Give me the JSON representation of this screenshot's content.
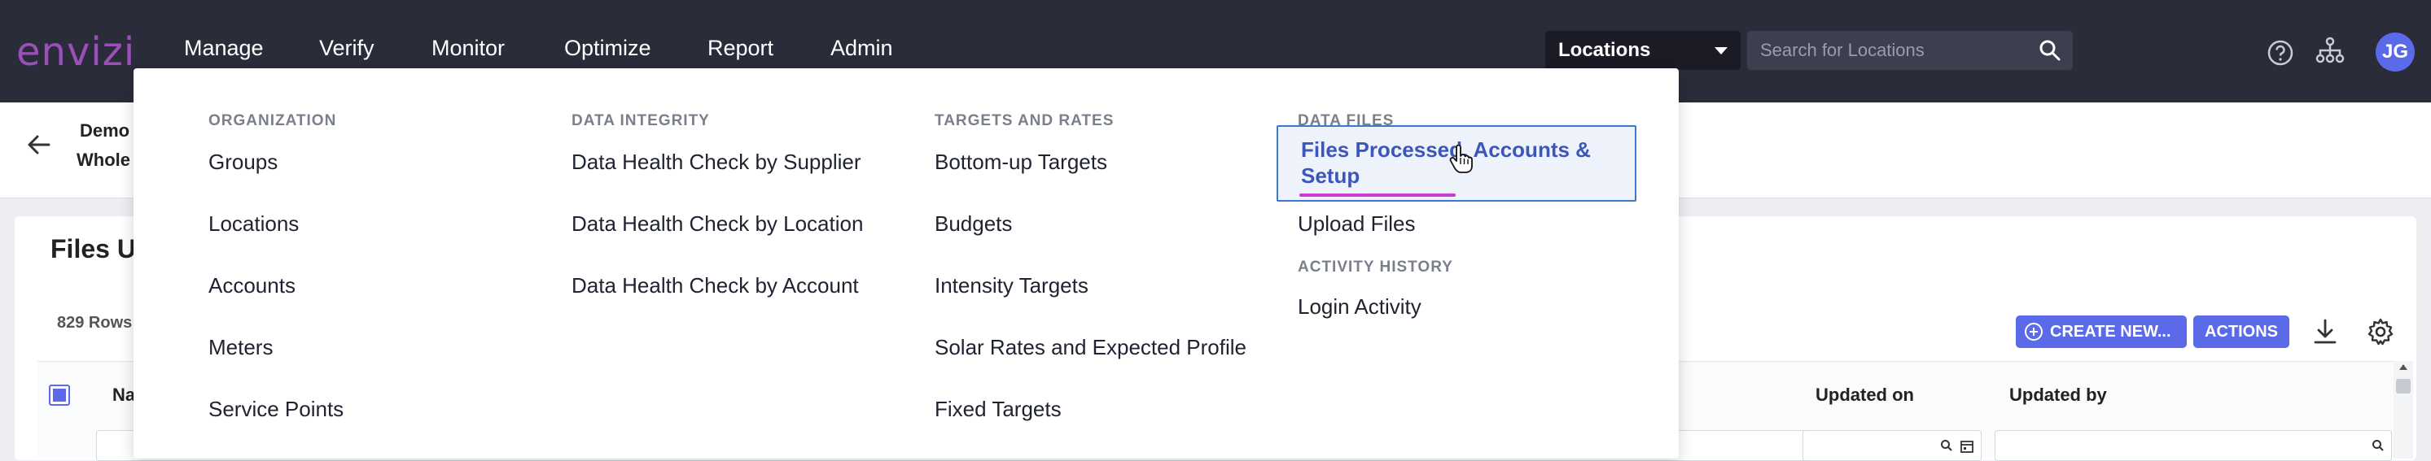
{
  "app": {
    "logo": "envizi"
  },
  "topnav": {
    "items": [
      "Manage",
      "Verify",
      "Monitor",
      "Optimize",
      "Report",
      "Admin"
    ],
    "active": "Manage",
    "location_select": "Locations",
    "search_placeholder": "Search for Locations",
    "user_initials": "JG"
  },
  "breadcrumb": {
    "line1": "Demo",
    "line2": "Whole"
  },
  "page": {
    "title": "Files U",
    "rows_count": "829 Rows",
    "create_button": "CREATE NEW...",
    "actions_button": "ACTIONS"
  },
  "grid": {
    "columns": [
      "Nam",
      "Updated on",
      "Updated by"
    ]
  },
  "mega_menu": {
    "organization": {
      "heading": "ORGANIZATION",
      "items": [
        "Groups",
        "Locations",
        "Accounts",
        "Meters",
        "Service Points"
      ]
    },
    "data_integrity": {
      "heading": "DATA INTEGRITY",
      "items": [
        "Data Health Check by Supplier",
        "Data Health Check by Location",
        "Data Health Check by Account"
      ]
    },
    "targets_rates": {
      "heading": "TARGETS AND RATES",
      "items": [
        "Bottom-up Targets",
        "Budgets",
        "Intensity Targets",
        "Solar Rates and Expected Profile",
        "Fixed Targets"
      ]
    },
    "data_files": {
      "heading": "DATA FILES",
      "items": [
        "Files Processed, Accounts & Setup",
        "Upload Files"
      ]
    },
    "activity_history": {
      "heading": "ACTIVITY HISTORY",
      "items": [
        "Login Activity"
      ]
    }
  },
  "colors": {
    "nav_bg": "#2a2c3a",
    "accent": "#5b6ae8",
    "underline": "#c93bd1",
    "logo": "#9b4fb8",
    "active_item_border": "#3d79c9"
  }
}
